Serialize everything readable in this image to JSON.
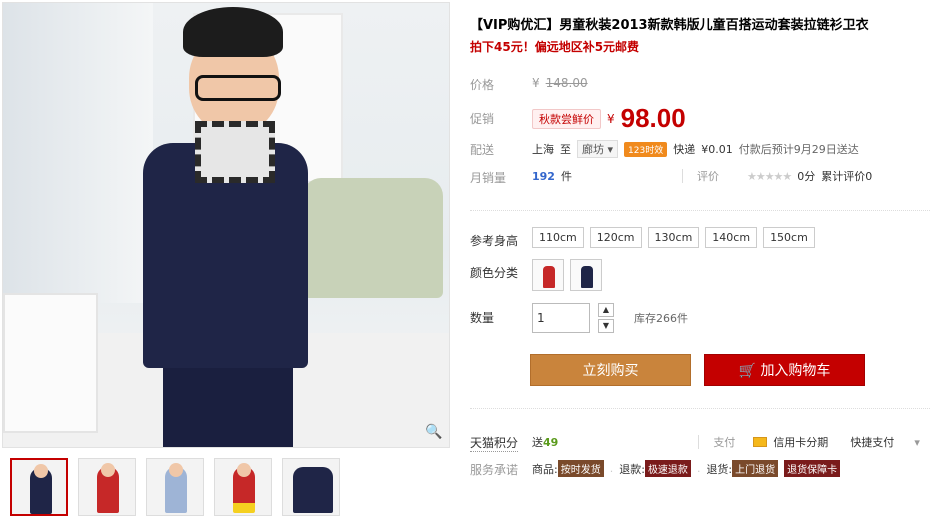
{
  "gallery": {
    "zoom_icon": "magnifier-icon",
    "thumbnails": [
      {
        "colors": [
          "#1f2547",
          "#ffffff"
        ]
      },
      {
        "colors": [
          "#c62828",
          "#ffffff"
        ]
      },
      {
        "colors": [
          "#9eb4d6",
          "#ffffff"
        ]
      },
      {
        "colors": [
          "#c62828",
          "#f5d020"
        ]
      },
      {
        "colors": [
          "#1f2547",
          "#ffffff"
        ]
      }
    ]
  },
  "product": {
    "title": "【VIP购优汇】男童秋装2013新款韩版儿童百搭运动套装拉链衫卫衣",
    "subtitle": "拍下45元！偏远地区补5元邮费"
  },
  "price": {
    "label": "价格",
    "currency": "¥",
    "original": "148.00"
  },
  "promo": {
    "label": "促销",
    "tag": "秋款尝鲜价",
    "currency": "¥",
    "price": "98.00"
  },
  "shipping": {
    "label": "配送",
    "from": "上海",
    "to_word": "至",
    "destination": "廊坊",
    "badge": "123时效",
    "method": "快递",
    "fee": "¥0.01",
    "note": "付款后预计9月29日送达"
  },
  "sales": {
    "label": "月销量",
    "count": "192",
    "unit": "件",
    "rating_label": "评价",
    "rating_score": "0分",
    "review_label": "累计评价",
    "review_count": "0"
  },
  "sizes": {
    "label": "参考身高",
    "options": [
      "110cm",
      "120cm",
      "130cm",
      "140cm",
      "150cm"
    ]
  },
  "colors": {
    "label": "颜色分类",
    "options": [
      {
        "swatch": "#c62828"
      },
      {
        "swatch": "#1f2547"
      }
    ]
  },
  "quantity": {
    "label": "数量",
    "value": "1",
    "stock": "库存266件"
  },
  "buttons": {
    "buy": "立刻购买",
    "cart": "加入购物车",
    "cart_icon": "shopping-cart-icon"
  },
  "points": {
    "label": "天猫积分",
    "text": "送",
    "value": "49",
    "pay_label": "支付",
    "credit": "信用卡分期",
    "fast_pay": "快捷支付"
  },
  "services": {
    "label": "服务承诺",
    "items": [
      {
        "prefix": "商品:",
        "badge": "按时发货"
      },
      {
        "prefix": "退款:",
        "badge": "极速退款"
      },
      {
        "prefix": "退货:",
        "badge": "上门退货"
      },
      {
        "prefix": "",
        "badge": "退货保障卡"
      }
    ]
  },
  "colors_theme": {
    "accent": "#c40000",
    "buy_button": "#c9843c"
  }
}
